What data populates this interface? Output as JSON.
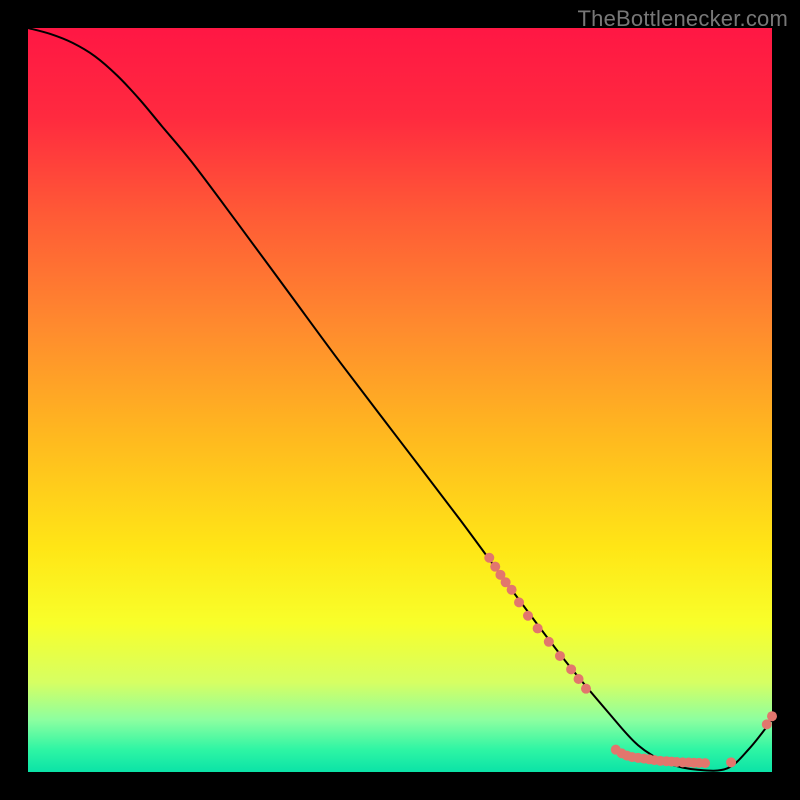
{
  "attribution": "TheBottlenecker.com",
  "chart_data": {
    "type": "line",
    "title": "",
    "xlabel": "",
    "ylabel": "",
    "xlim": [
      0,
      100
    ],
    "ylim": [
      0,
      100
    ],
    "background_gradient": {
      "stops": [
        {
          "offset": 0.0,
          "color": "#ff1744"
        },
        {
          "offset": 0.12,
          "color": "#ff2a3f"
        },
        {
          "offset": 0.25,
          "color": "#ff5a36"
        },
        {
          "offset": 0.4,
          "color": "#ff8a2e"
        },
        {
          "offset": 0.55,
          "color": "#ffb91f"
        },
        {
          "offset": 0.7,
          "color": "#ffe616"
        },
        {
          "offset": 0.8,
          "color": "#f8ff2a"
        },
        {
          "offset": 0.88,
          "color": "#d6ff63"
        },
        {
          "offset": 0.93,
          "color": "#8cffa0"
        },
        {
          "offset": 0.97,
          "color": "#2ef5a4"
        },
        {
          "offset": 1.0,
          "color": "#0be3a7"
        }
      ]
    },
    "series": [
      {
        "name": "bottleneck-curve",
        "color": "#000000",
        "x": [
          0,
          3,
          6,
          9,
          12,
          15,
          18,
          22,
          28,
          35,
          42,
          50,
          58,
          65,
          72,
          78,
          82,
          86,
          90,
          94,
          97,
          100
        ],
        "y": [
          100,
          99.2,
          98.0,
          96.2,
          93.6,
          90.4,
          86.8,
          82.0,
          74.0,
          64.5,
          55.0,
          44.5,
          34.0,
          24.5,
          15.2,
          8.0,
          3.6,
          1.2,
          0.3,
          0.5,
          3.2,
          7.0
        ]
      }
    ],
    "scatter_points": {
      "name": "data-markers",
      "color": "#e2766d",
      "points": [
        {
          "x": 62.0,
          "y": 28.8
        },
        {
          "x": 62.8,
          "y": 27.6
        },
        {
          "x": 63.5,
          "y": 26.5
        },
        {
          "x": 64.2,
          "y": 25.5
        },
        {
          "x": 65.0,
          "y": 24.5
        },
        {
          "x": 66.0,
          "y": 22.8
        },
        {
          "x": 67.2,
          "y": 21.0
        },
        {
          "x": 68.5,
          "y": 19.3
        },
        {
          "x": 70.0,
          "y": 17.5
        },
        {
          "x": 71.5,
          "y": 15.6
        },
        {
          "x": 73.0,
          "y": 13.8
        },
        {
          "x": 74.0,
          "y": 12.5
        },
        {
          "x": 75.0,
          "y": 11.2
        },
        {
          "x": 79.0,
          "y": 3.0
        },
        {
          "x": 79.8,
          "y": 2.5
        },
        {
          "x": 80.5,
          "y": 2.2
        },
        {
          "x": 81.2,
          "y": 2.0
        },
        {
          "x": 82.0,
          "y": 1.9
        },
        {
          "x": 82.8,
          "y": 1.8
        },
        {
          "x": 83.5,
          "y": 1.7
        },
        {
          "x": 84.2,
          "y": 1.6
        },
        {
          "x": 85.0,
          "y": 1.5
        },
        {
          "x": 85.8,
          "y": 1.45
        },
        {
          "x": 86.5,
          "y": 1.4
        },
        {
          "x": 87.2,
          "y": 1.35
        },
        {
          "x": 88.0,
          "y": 1.3
        },
        {
          "x": 88.8,
          "y": 1.28
        },
        {
          "x": 89.5,
          "y": 1.25
        },
        {
          "x": 90.2,
          "y": 1.23
        },
        {
          "x": 91.0,
          "y": 1.2
        },
        {
          "x": 94.5,
          "y": 1.3
        },
        {
          "x": 99.3,
          "y": 6.4
        },
        {
          "x": 100.0,
          "y": 7.5
        }
      ]
    }
  }
}
